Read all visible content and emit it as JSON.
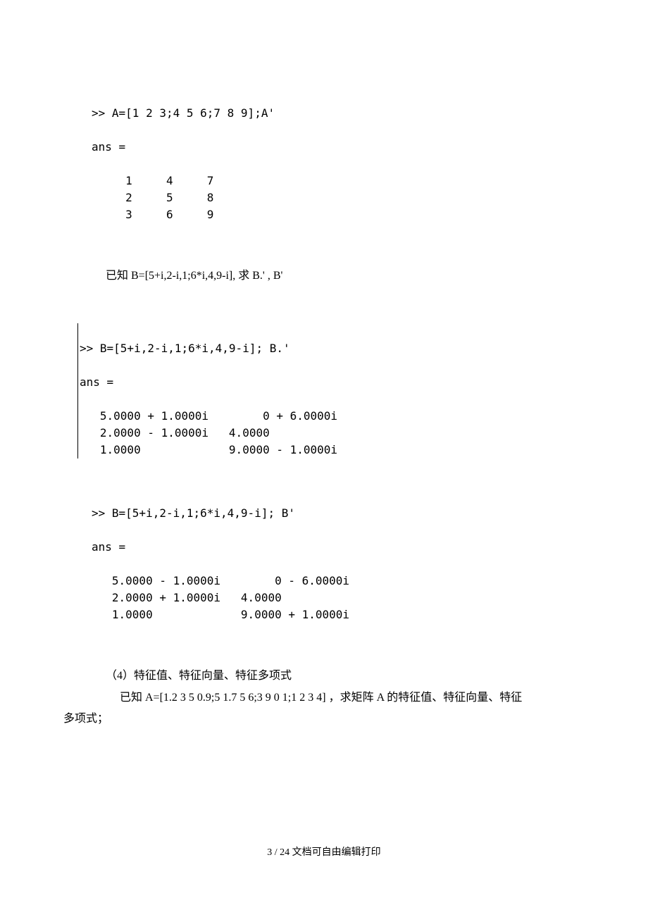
{
  "block1": {
    "line1": ">> A=[1 2 3;4 5 6;7 8 9];A'",
    "ans": "ans =",
    "row1": "     1     4     7",
    "row2": "     2     5     8",
    "row3": "     3     6     9"
  },
  "prompt1": "已知  B=[5+i,2-i,1;6*i,4,9-i],  求  B.'   , B'",
  "block2": {
    "line1": ">> B=[5+i,2-i,1;6*i,4,9-i]; B.'",
    "ans": "ans =",
    "row1": "   5.0000 + 1.0000i        0 + 6.0000i",
    "row2": "   2.0000 - 1.0000i   4.0000          ",
    "row3": "   1.0000             9.0000 - 1.0000i"
  },
  "block3": {
    "line1": ">> B=[5+i,2-i,1;6*i,4,9-i]; B'",
    "ans": "ans =",
    "row1": "   5.0000 - 1.0000i        0 - 6.0000i",
    "row2": "   2.0000 + 1.0000i   4.0000          ",
    "row3": "   1.0000             9.0000 + 1.0000i"
  },
  "section4": {
    "heading": "（4）特征值、特征向量、特征多项式",
    "body1": "已知  A=[1.2 3 5 0.9;5 1.7 5 6;3 9 0 1;1 2 3 4]  ，求矩阵  A 的特征值、特征向量、特征",
    "body2": "多项式；"
  },
  "footer": "3 / 24 文档可自由编辑打印"
}
